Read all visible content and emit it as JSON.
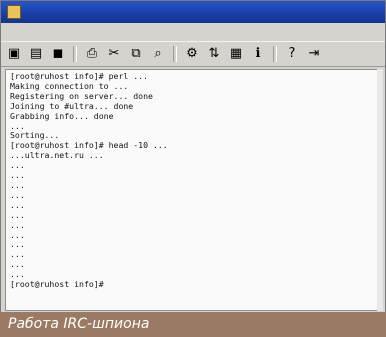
{
  "window": {
    "title": "",
    "menu": [
      "",
      "",
      "",
      "",
      "",
      "",
      "",
      ""
    ],
    "toolbar_icons": [
      "new-icon",
      "open-icon",
      "save-icon",
      "print-icon",
      "cut-icon",
      "copy-icon",
      "find-icon",
      "settings-icon",
      "sort-icon",
      "stats-icon",
      "sort-icon",
      "info-icon",
      "help-icon",
      "exit-icon"
    ]
  },
  "console": {
    "lines": [
      "[root@ruhost info]# perl ...",
      "Making connection to ...",
      "Registering on server... done",
      "Joining to #ultra... done",
      "Grabbing info... done",
      "...",
      "Sorting...",
      "[root@ruhost info]# head -10 ...",
      "...ultra.net.ru ...",
      "...",
      "...",
      "...",
      "...",
      "...",
      "...",
      "...",
      "...",
      "...",
      "...",
      "...",
      "...",
      "[root@ruhost info]#"
    ]
  },
  "caption": "Работа IRC-шпиона"
}
